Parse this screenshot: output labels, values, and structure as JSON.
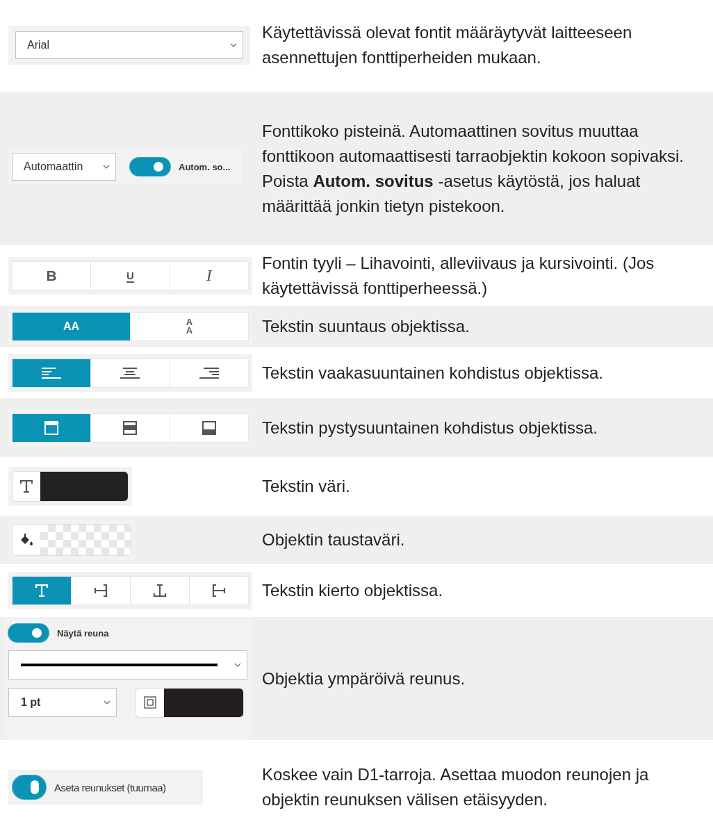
{
  "rows": [
    {
      "kind": "font",
      "value": "Arial",
      "description": "Käytettävissä olevat fontit määräytyvät laitteeseen asennettujen fonttiperheiden mukaan."
    },
    {
      "kind": "size",
      "value": "Automaattin",
      "toggle": {
        "label": "Autom. so...",
        "on": true
      },
      "description": "Fonttikoko pisteinä. Automaattinen sovitus muuttaa fonttikoon automaattisesti tarraobjektin kokoon sopivaksi. Poista **Autom. sovitus** -asetus käytöstä, jos haluat määrittää jonkin tietyn pistekoon."
    },
    {
      "kind": "buttons",
      "buttons": [
        {
          "kind": "bold",
          "label": "B",
          "selected": false
        },
        {
          "kind": "underline",
          "label": "U",
          "selected": false
        },
        {
          "kind": "italic",
          "label": "I",
          "selected": false
        }
      ],
      "description": "Fontin tyyli – Lihavointi, alleviivaus ja kursivointi. (Jos käytettävissä fonttiperheessä.)"
    },
    {
      "kind": "buttons",
      "buttons": [
        {
          "kind": "horizontal",
          "label": "AA",
          "selected": true
        },
        {
          "kind": "vertical",
          "label": "AA",
          "selected": false
        }
      ],
      "description": "Tekstin suuntaus objektissa."
    },
    {
      "kind": "buttons",
      "buttons": [
        {
          "kind": "align-left",
          "selected": true
        },
        {
          "kind": "align-center",
          "selected": false
        },
        {
          "kind": "align-right",
          "selected": false
        }
      ],
      "description": "Tekstin vaakasuuntainen kohdistus objektissa."
    },
    {
      "kind": "buttons",
      "buttons": [
        {
          "kind": "align-top",
          "selected": true
        },
        {
          "kind": "align-middle",
          "selected": false
        },
        {
          "kind": "align-bottom",
          "selected": false
        }
      ],
      "description": "Tekstin pystysuuntainen kohdistus objektissa."
    },
    {
      "kind": "color",
      "color": "#222222",
      "description": "Tekstin väri."
    },
    {
      "kind": "fill",
      "description": "Objektin taustaväri."
    },
    {
      "kind": "buttons",
      "buttons": [
        {
          "kind": "rotate-0",
          "selected": true
        },
        {
          "kind": "rotate-90",
          "selected": false
        },
        {
          "kind": "rotate-180",
          "selected": false
        },
        {
          "kind": "rotate-270",
          "selected": false
        }
      ],
      "description": "Tekstin kierto objektissa."
    },
    {
      "kind": "border",
      "toggle": {
        "label": "Näytä reuna",
        "on": true
      },
      "value": "1 pt",
      "color": "#231f20",
      "description": "Objektia ympäröivä reunus."
    },
    {
      "kind": "margins",
      "toggle": {
        "label": "Aseta reunukset (tuumaa)",
        "on": true
      },
      "description": "Koskee vain D1-tarroja. Asettaa muodon reunojen ja objektin reunuksen välisen etäisyyden."
    }
  ]
}
